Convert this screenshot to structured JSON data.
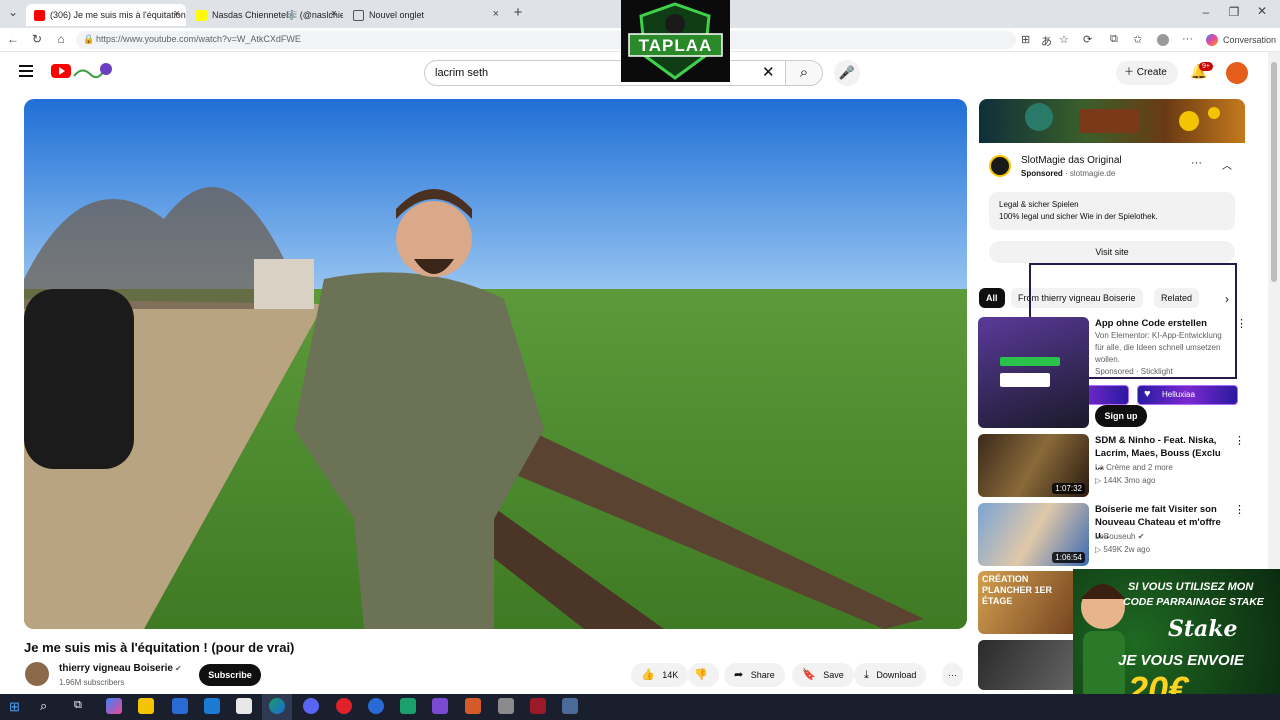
{
  "browser": {
    "tabs": [
      {
        "label": "(306) Je me suis mis à l'équitation",
        "active": true
      },
      {
        "label": "Nasdas Chiennete🎼 (@naslchien",
        "active": false
      },
      {
        "label": "Nouvel onglet",
        "active": false
      }
    ],
    "url": "https://www.youtube.com/watch?v=W_AtkCXdFWE",
    "conversation_label": "Conversation"
  },
  "yt": {
    "search_value": "lacrim seth",
    "create_label": "Create",
    "notif_badge": "9+",
    "overlay_logo_text": "TAPLAA"
  },
  "video": {
    "title": "Je me suis mis à l'équitation ! (pour de vrai)",
    "channel": "thierry vigneau Boiserie",
    "subscribers": "1.96M subscribers",
    "subscribe_label": "Subscribe",
    "likes": "14K",
    "share_label": "Share",
    "save_label": "Save",
    "download_label": "Download"
  },
  "ad": {
    "name": "SlotMagie das Original",
    "sponsored": "Sponsored",
    "domain": "· slotmagie.de",
    "box_title": "Legal & sicher Spielen",
    "box_text": "100% legal und sicher Wie in der Spielothek.",
    "visit_label": "Visit site"
  },
  "chips": [
    "All",
    "From thierry vigneau Boiserie",
    "Related"
  ],
  "recs": [
    {
      "title": "App ohne Code erstellen",
      "channel": "Von Elementor: KI-App-Entwicklung für alle, die Ideen schnell umsetzen wollen.",
      "meta": "Sponsored · Sticklight",
      "duration": ""
    },
    {
      "title": "SDM & Ninho - Feat. Niska, Lacrim, Maes, Bouss (Exclu ...",
      "channel": "La Crème and 2 more",
      "meta": "▷ 144K   3mo ago",
      "duration": "1:07:32"
    },
    {
      "title": "Boiserie me fait Visiter son Nouveau Chateau et m'offre u...",
      "channel": "LeBouseuh ✔",
      "meta": "▷ 549K   2w ago",
      "duration": "1:06:54"
    }
  ],
  "signup_label": "Sign up",
  "overlay_names": [
    "Helluxiaa"
  ],
  "stake": {
    "line1": "SI VOUS UTILISEZ MON",
    "line2": "CODE PARRAINAGE STAKE",
    "brand": "Stake",
    "line3": "JE VOUS ENVOIE",
    "amount": "20€"
  },
  "rec4_thumb_text": "CRÉATION PLANCHER 1ER ÉTAGE"
}
